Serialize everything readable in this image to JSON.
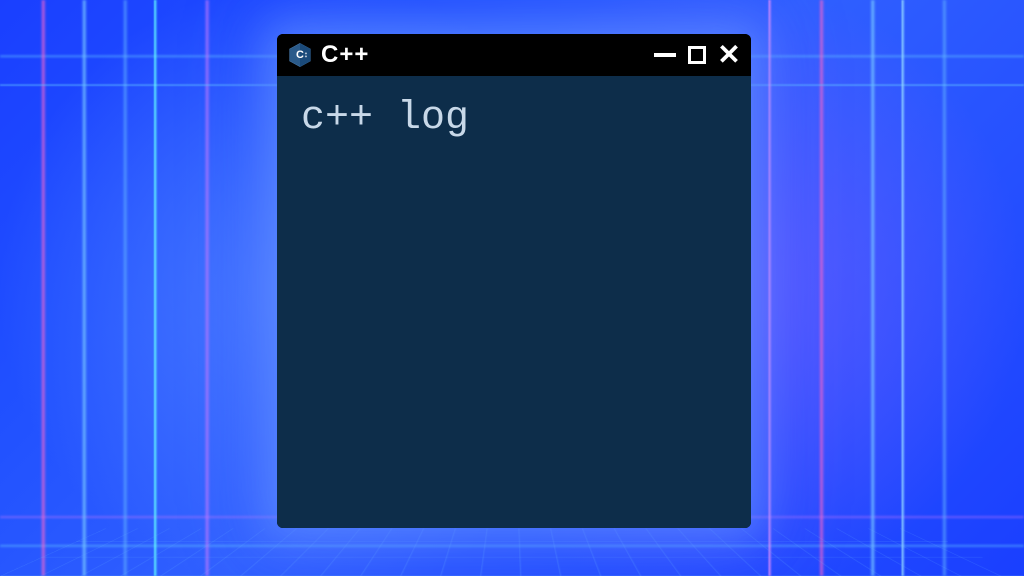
{
  "window": {
    "title": "C++",
    "icon": "cpp-icon"
  },
  "terminal": {
    "content": "c++ log"
  },
  "colors": {
    "terminal_bg": "#0d2d4a",
    "terminal_text": "#c8d8e8",
    "titlebar_bg": "#000000"
  }
}
